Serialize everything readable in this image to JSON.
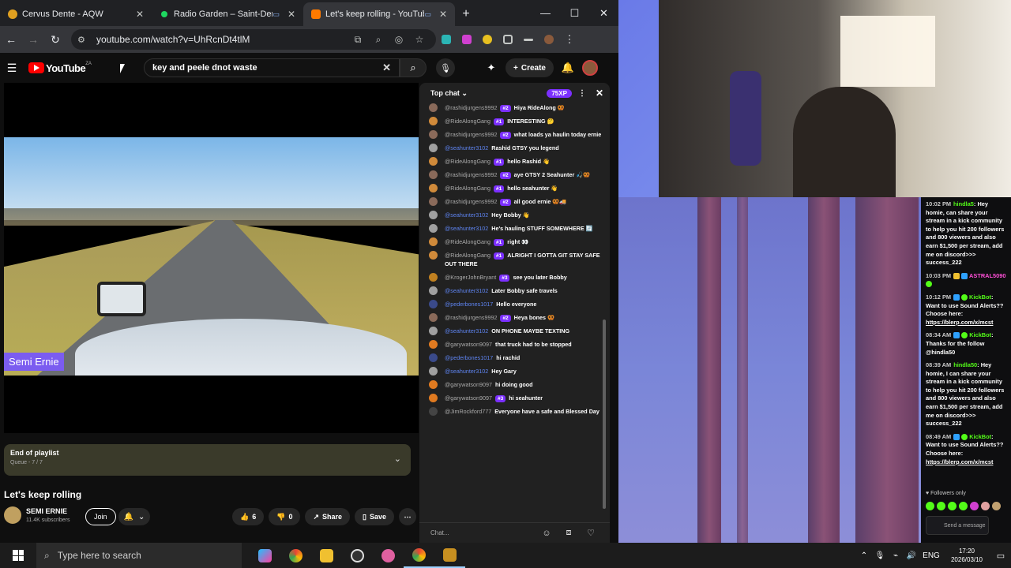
{
  "browser": {
    "tabs": [
      {
        "label": "Cervus Dente - AQW",
        "favicon_color": "#e0a020",
        "active": false
      },
      {
        "label": "Radio Garden – Saint-Denis",
        "favicon_color": "#1ed760",
        "active": false
      },
      {
        "label": "Let's keep rolling - YouTube",
        "favicon_color": "#ff7a00",
        "active": true
      }
    ],
    "url": "youtube.com/watch?v=UhRcnDt4tlM",
    "window_controls": {
      "minimize": "—",
      "maximize": "☐",
      "close": "✕"
    }
  },
  "youtube": {
    "logo_text": "YouTube",
    "logo_country": "ZA",
    "search_query": "key and peele dnot waste",
    "create_label": "Create",
    "video_overlay_name": "Semi Ernie",
    "playlist": {
      "title": "End of playlist",
      "queue": "Queue - 7 / 7"
    },
    "video_title": "Let's keep rolling",
    "channel": {
      "name": "SEMI ERNIE",
      "subscribers": "11.4K subscribers"
    },
    "join_label": "Join",
    "likes": "6",
    "dislikes": "0",
    "share_label": "Share",
    "save_label": "Save"
  },
  "chat": {
    "header": "Top chat",
    "xp": "75XP",
    "placeholder": "Chat...",
    "messages": [
      {
        "author": "@rashidjurgens9992",
        "badge": "#2",
        "text": "Hiya RideAlong",
        "emoji": "🥨",
        "avatar_color": "#8a6a5a",
        "mod": false
      },
      {
        "author": "@RideAlongGang",
        "badge": "#1",
        "text": "INTERESTING",
        "emoji": "🤔",
        "avatar_color": "#d08a3a",
        "mod": false
      },
      {
        "author": "@rashidjurgens9992",
        "badge": "#2",
        "text": "what loads ya haulin today ernie",
        "emoji": "",
        "avatar_color": "#8a6a5a",
        "mod": false
      },
      {
        "author": "@seahunter3102",
        "badge": "",
        "text": "Rashid GTSY you legend",
        "emoji": "",
        "avatar_color": "#a0a0a0",
        "mod": true
      },
      {
        "author": "@RideAlongGang",
        "badge": "#1",
        "text": "hello Rashid",
        "emoji": "👋",
        "avatar_color": "#d08a3a",
        "mod": false
      },
      {
        "author": "@rashidjurgens9992",
        "badge": "#2",
        "text": "aye GTSY 2 Seahunter",
        "emoji": "🎣🥨",
        "avatar_color": "#8a6a5a",
        "mod": false
      },
      {
        "author": "@RideAlongGang",
        "badge": "#1",
        "text": "hello seahunter",
        "emoji": "👋",
        "avatar_color": "#d08a3a",
        "mod": false
      },
      {
        "author": "@rashidjurgens9992",
        "badge": "#2",
        "text": "all good ernie",
        "emoji": "🥨🚚",
        "avatar_color": "#8a6a5a",
        "mod": false
      },
      {
        "author": "@seahunter3102",
        "badge": "",
        "text": "Hey Bobby",
        "emoji": "👋",
        "avatar_color": "#a0a0a0",
        "mod": true
      },
      {
        "author": "@seahunter3102",
        "badge": "",
        "text": "He's hauling STUFF SOMEWHERE",
        "emoji": "🔄",
        "avatar_color": "#a0a0a0",
        "mod": true
      },
      {
        "author": "@RideAlongGang",
        "badge": "#1",
        "text": "right",
        "emoji": "👀",
        "avatar_color": "#d08a3a",
        "mod": false
      },
      {
        "author": "@RideAlongGang",
        "badge": "#1",
        "text": "ALRIGHT I GOTTA GIT STAY SAFE OUT THERE",
        "emoji": "",
        "avatar_color": "#d08a3a",
        "mod": false
      },
      {
        "author": "@KrogerJohnBryant",
        "badge": "#3",
        "text": "see you later Bobby",
        "emoji": "",
        "avatar_color": "#c08020",
        "mod": false
      },
      {
        "author": "@seahunter3102",
        "badge": "",
        "text": "Later Bobby safe travels",
        "emoji": "",
        "avatar_color": "#a0a0a0",
        "mod": true
      },
      {
        "author": "@pederbones1017",
        "badge": "",
        "text": "Hello everyone",
        "emoji": "",
        "avatar_color": "#3a4a8a",
        "mod": true
      },
      {
        "author": "@rashidjurgens9992",
        "badge": "#2",
        "text": "Heya bones",
        "emoji": "🥨",
        "avatar_color": "#8a6a5a",
        "mod": false
      },
      {
        "author": "@seahunter3102",
        "badge": "",
        "text": "ON PHONE MAYBE TEXTING",
        "emoji": "",
        "avatar_color": "#a0a0a0",
        "mod": true
      },
      {
        "author": "@garywatson9097",
        "badge": "",
        "text": "that truck had to be stopped",
        "emoji": "",
        "avatar_color": "#e07a20",
        "mod": false
      },
      {
        "author": "@pederbones1017",
        "badge": "",
        "text": "hi rachid",
        "emoji": "",
        "avatar_color": "#3a4a8a",
        "mod": true
      },
      {
        "author": "@seahunter3102",
        "badge": "",
        "text": "Hey Gary",
        "emoji": "",
        "avatar_color": "#a0a0a0",
        "mod": true
      },
      {
        "author": "@garywatson9097",
        "badge": "",
        "text": "hi doing good",
        "emoji": "",
        "avatar_color": "#e07a20",
        "mod": false
      },
      {
        "author": "@garywatson9097",
        "badge": "#3",
        "text": "hi seahunter",
        "emoji": "",
        "avatar_color": "#e07a20",
        "mod": false
      },
      {
        "author": "@JimRockford777",
        "badge": "",
        "text": "Everyone have a safe and Blessed Day",
        "emoji": "",
        "avatar_color": "#444",
        "mod": false
      }
    ]
  },
  "kick_chat": {
    "messages": [
      {
        "time": "10:02 PM",
        "user": "hindla5",
        "text": "Hey homie, can share your stream in a kick community to help you hit 200 followers and 800 viewers and also earn $1,500 per stream, add me on discord>>> success_222",
        "link": ""
      },
      {
        "time": "10:03 PM",
        "user": "ASTRAL5090",
        "text": "",
        "link": ""
      },
      {
        "time": "10:12 PM",
        "user": "KickBot",
        "text": "Want to use Sound Alerts?? Choose here:",
        "link": "https://blerp.com/x/mcst"
      },
      {
        "time": "08:34 AM",
        "user": "KickBot",
        "text": "Thanks for the follow @hindla50",
        "link": ""
      },
      {
        "time": "08:39 AM",
        "user": "hindla50",
        "text": "Hey homie, I can share your stream in a kick community to help you hit 200 followers and 800 viewers and also earn $1,500 per stream, add me on discord>>> success_222",
        "link": ""
      },
      {
        "time": "08:49 AM",
        "user": "KickBot",
        "text": "Want to use Sound Alerts?? Choose here:",
        "link": "https://blerp.com/x/mcst"
      }
    ],
    "followers_only": "Followers only",
    "send_placeholder": "Send a message"
  },
  "taskbar": {
    "search_placeholder": "Type here to search",
    "language": "ENG",
    "time": "17:20",
    "date": "2026/03/10"
  }
}
